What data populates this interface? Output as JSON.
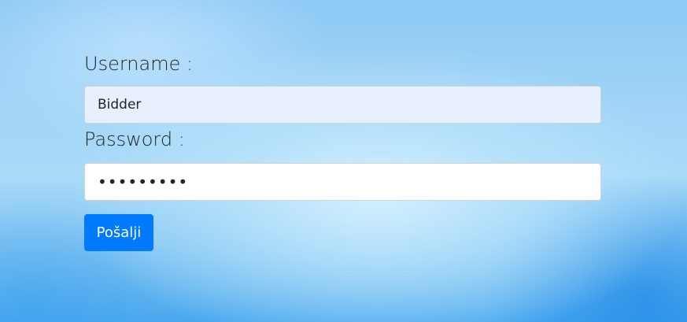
{
  "form": {
    "username_label": "Username :",
    "username_value": "Bidder",
    "password_label": "Password :",
    "password_value": "•••••••••",
    "submit_label": "Pošalji"
  },
  "colors": {
    "button": "#007bff",
    "username_field_bg": "#e8f0fe",
    "text": "#212529"
  }
}
